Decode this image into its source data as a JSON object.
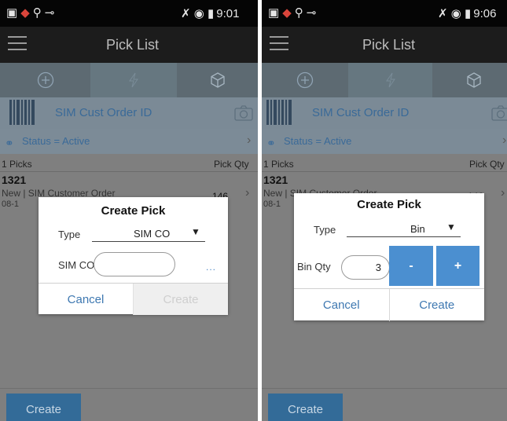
{
  "statusbar": {
    "time_left": "9:01",
    "time_right": "9:06"
  },
  "app": {
    "title": "Pick List"
  },
  "scan": {
    "label": "SIM Cust Order ID"
  },
  "filter": {
    "label": "Status = Active"
  },
  "list": {
    "count_label": "1 Picks",
    "qty_header": "Pick Qty",
    "rows": [
      {
        "id": "1321",
        "desc": "New  |  SIM Customer Order",
        "date": "08-1",
        "qty": "146"
      }
    ]
  },
  "bottom": {
    "create_label": "Create"
  },
  "dialog_left": {
    "title": "Create Pick",
    "type_label": "Type",
    "type_value": "SIM CO",
    "field_label": "SIM CO",
    "field_value": "",
    "more": "...",
    "cancel": "Cancel",
    "create": "Create"
  },
  "dialog_right": {
    "title": "Create Pick",
    "type_label": "Type",
    "type_value": "Bin",
    "qty_label": "Bin Qty",
    "qty_value": "3",
    "minus": "-",
    "plus": "+",
    "cancel": "Cancel",
    "create": "Create"
  },
  "icons": [
    "add-circle-icon",
    "lightning-icon",
    "cube-icon",
    "barcode-icon",
    "camera-icon",
    "glasses-icon",
    "chevron-right-icon",
    "menu-icon",
    "dropdown-arrow-icon"
  ]
}
